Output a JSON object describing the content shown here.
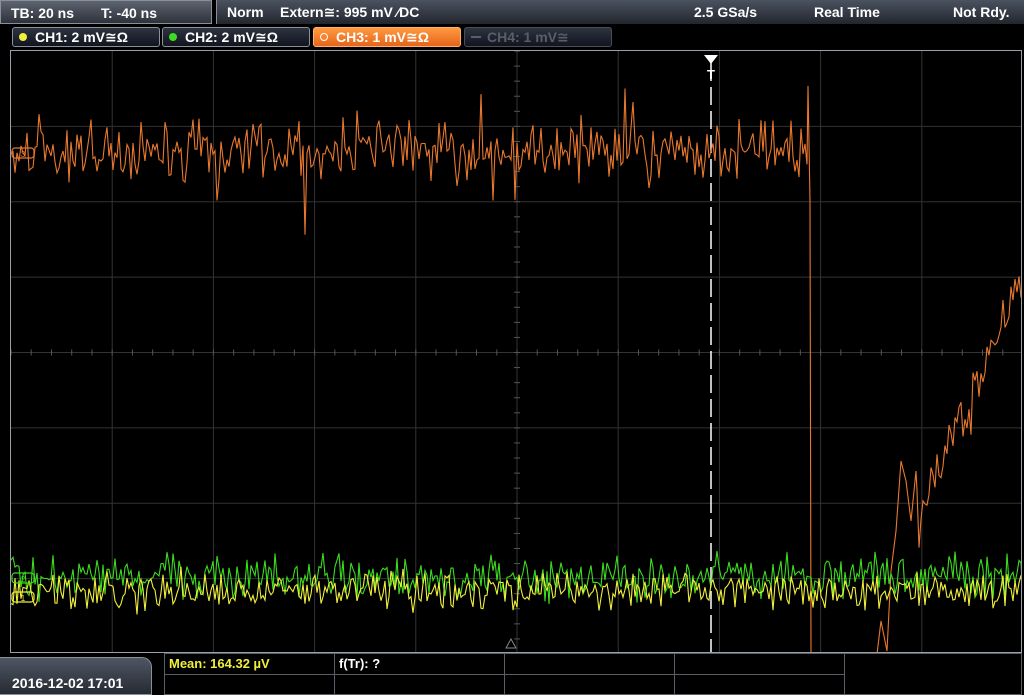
{
  "topbar": {
    "timebase": "TB: 20 ns",
    "trigger_time": "T: -40 ns",
    "trigger_mode": "Norm",
    "trigger_source": "Extern≅: 995 mV ∕DC",
    "sample_rate": "2.5 GSa/s",
    "acq_mode": "Real Time",
    "status": "Not Rdy."
  },
  "channels": [
    {
      "label": "CH1: 2 mV≅Ω",
      "color": "#f0f03c",
      "state": "on"
    },
    {
      "label": "CH2: 2 mV≅Ω",
      "color": "#3cdc1e",
      "state": "on"
    },
    {
      "label": "CH3: 1 mV≅Ω",
      "color": "#ff7f2a",
      "state": "active"
    },
    {
      "label": "CH4: 1 mV≅",
      "color": "#5a5e66",
      "state": "off"
    }
  ],
  "trigger_marker": "T",
  "channel_markers": {
    "ch3": "3",
    "ch1": "1",
    "ch2": "2"
  },
  "datetime": "2016-12-02 17:01",
  "measurements": {
    "mean": "Mean: 164.32 µV",
    "ftr": "f(Tr): ?"
  },
  "colors": {
    "ch1": "#f0f03c",
    "ch2": "#3cdc1e",
    "ch3": "#e8782e",
    "grid": "#3a3a3a",
    "mean_text": "#f0f03c"
  }
}
